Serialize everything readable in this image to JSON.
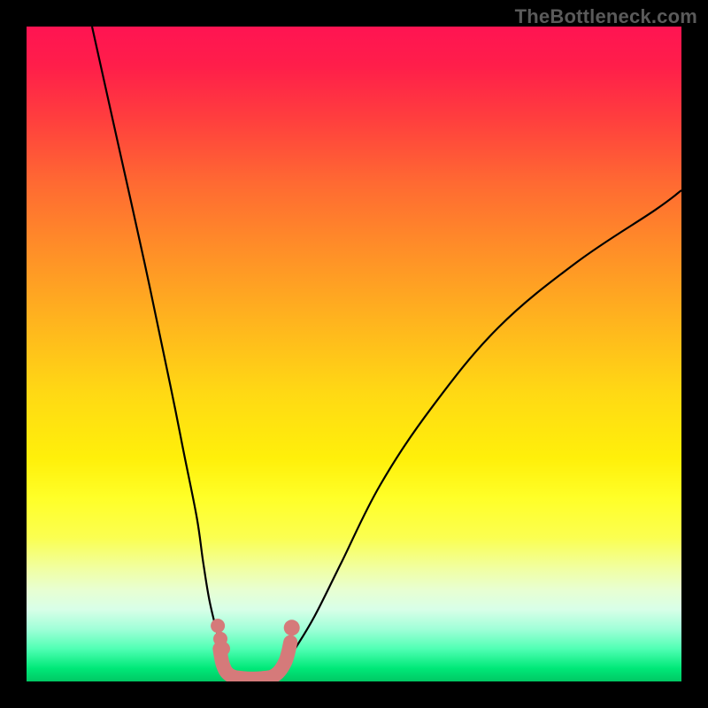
{
  "watermark": "TheBottleneck.com",
  "colors": {
    "background": "#000000",
    "curve": "#000000",
    "marker": "#d57a7a",
    "gradient_top": "#ff1452",
    "gradient_bottom": "#00c864"
  },
  "chart_data": {
    "type": "line",
    "title": "",
    "xlabel": "",
    "ylabel": "",
    "xlim": [
      0,
      100
    ],
    "ylim": [
      0,
      100
    ],
    "note": "Axes are unlabeled in the source image; values are normalized 0–100 estimates read from pixel positions (y=0 at bottom green band, y=100 at top red band).",
    "series": [
      {
        "name": "left-branch",
        "x": [
          10,
          14,
          18,
          22,
          24,
          26,
          27,
          28,
          29.5,
          30.5,
          31.5,
          33,
          35
        ],
        "y": [
          100,
          82,
          64,
          45,
          35,
          25,
          18,
          12,
          6,
          3,
          1.5,
          0.5,
          0
        ]
      },
      {
        "name": "right-branch",
        "x": [
          35,
          37,
          39,
          41,
          44,
          48,
          54,
          62,
          72,
          84,
          96,
          100
        ],
        "y": [
          0,
          0.5,
          2,
          5,
          10,
          18,
          30,
          42,
          54,
          64,
          72,
          75
        ]
      }
    ],
    "markers": {
      "name": "sweet-spot-band",
      "description": "Pink U-shaped highlight near the curve minimum with three dots on the left and one on the right",
      "u_path_x": [
        29.5,
        30,
        31,
        33,
        36,
        38,
        39.5,
        40.3
      ],
      "u_path_y": [
        5,
        2.5,
        1,
        0.5,
        0.5,
        1,
        3,
        6
      ],
      "left_dots": [
        {
          "x": 29.2,
          "y": 8.5
        },
        {
          "x": 29.6,
          "y": 6.5
        },
        {
          "x": 30.0,
          "y": 5.0
        }
      ],
      "right_dot": {
        "x": 40.5,
        "y": 8.2
      }
    }
  }
}
